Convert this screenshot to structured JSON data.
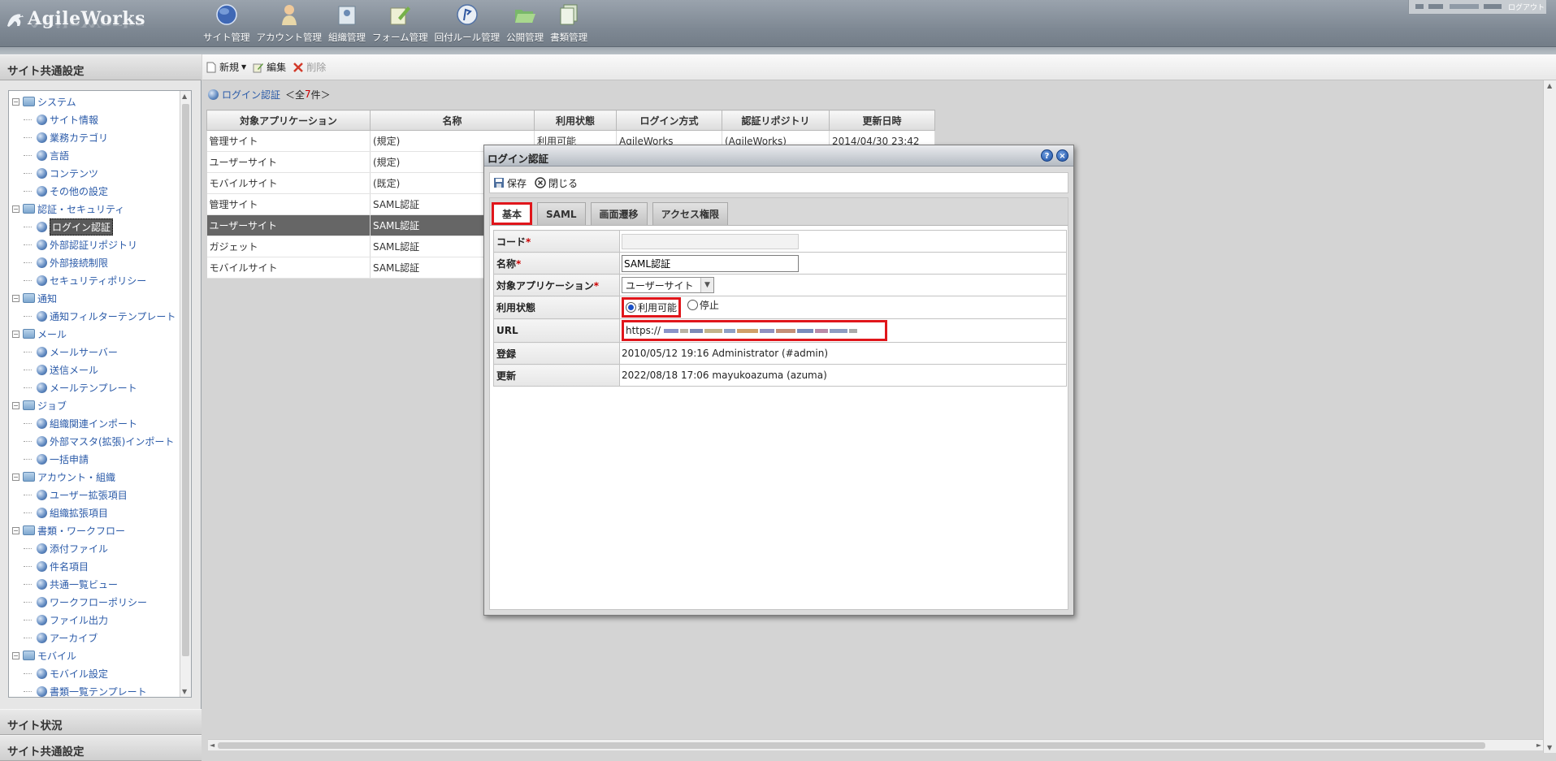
{
  "app": {
    "logo_text": "AgileWorks",
    "logout": "ログアウト"
  },
  "nav": [
    {
      "label": "サイト管理",
      "icon": "globe-icon"
    },
    {
      "label": "アカウント管理",
      "icon": "user-icon"
    },
    {
      "label": "組織管理",
      "icon": "organization-icon"
    },
    {
      "label": "フォーム管理",
      "icon": "form-edit-icon"
    },
    {
      "label": "回付ルール管理",
      "icon": "route-rule-icon"
    },
    {
      "label": "公開管理",
      "icon": "folder-open-icon"
    },
    {
      "label": "書類管理",
      "icon": "documents-icon"
    }
  ],
  "left": {
    "title": "サイト共通設定",
    "tree": [
      {
        "label": "システム",
        "type": "folder"
      },
      {
        "label": "サイト情報",
        "type": "leaf"
      },
      {
        "label": "業務カテゴリ",
        "type": "leaf"
      },
      {
        "label": "言語",
        "type": "leaf"
      },
      {
        "label": "コンテンツ",
        "type": "leaf"
      },
      {
        "label": "その他の設定",
        "type": "leaf"
      },
      {
        "label": "認証・セキュリティ",
        "type": "folder"
      },
      {
        "label": "ログイン認証",
        "type": "leaf",
        "selected": true
      },
      {
        "label": "外部認証リポジトリ",
        "type": "leaf"
      },
      {
        "label": "外部接続制限",
        "type": "leaf"
      },
      {
        "label": "セキュリティポリシー",
        "type": "leaf"
      },
      {
        "label": "通知",
        "type": "folder"
      },
      {
        "label": "通知フィルターテンプレート",
        "type": "leaf"
      },
      {
        "label": "メール",
        "type": "folder"
      },
      {
        "label": "メールサーバー",
        "type": "leaf"
      },
      {
        "label": "送信メール",
        "type": "leaf"
      },
      {
        "label": "メールテンプレート",
        "type": "leaf"
      },
      {
        "label": "ジョブ",
        "type": "folder"
      },
      {
        "label": "組織関連インポート",
        "type": "leaf"
      },
      {
        "label": "外部マスタ(拡張)インポート",
        "type": "leaf"
      },
      {
        "label": "一括申請",
        "type": "leaf"
      },
      {
        "label": "アカウント・組織",
        "type": "folder"
      },
      {
        "label": "ユーザー拡張項目",
        "type": "leaf"
      },
      {
        "label": "組織拡張項目",
        "type": "leaf"
      },
      {
        "label": "書類・ワークフロー",
        "type": "folder"
      },
      {
        "label": "添付ファイル",
        "type": "leaf"
      },
      {
        "label": "件名項目",
        "type": "leaf"
      },
      {
        "label": "共通一覧ビュー",
        "type": "leaf"
      },
      {
        "label": "ワークフローポリシー",
        "type": "leaf"
      },
      {
        "label": "ファイル出力",
        "type": "leaf"
      },
      {
        "label": "アーカイブ",
        "type": "leaf"
      },
      {
        "label": "モバイル",
        "type": "folder"
      },
      {
        "label": "モバイル設定",
        "type": "leaf"
      },
      {
        "label": "書類一覧テンプレート",
        "type": "leaf"
      }
    ],
    "bottom_titles": [
      "サイト状況",
      "サイト共通設定"
    ]
  },
  "toolbar": {
    "new_label": "新規",
    "edit_label": "編集",
    "delete_label": "削除"
  },
  "list": {
    "title": "ログイン認証",
    "count_prefix": "＜全",
    "count": "7",
    "count_suffix": "件＞",
    "columns": [
      "対象アプリケーション",
      "名称",
      "利用状態",
      "ログイン方式",
      "認証リポジトリ",
      "更新日時"
    ],
    "rows": [
      [
        "管理サイト",
        "(規定)",
        "利用可能",
        "AgileWorks",
        "(AgileWorks)",
        "2014/04/30 23:42"
      ],
      [
        "ユーザーサイト",
        "(規定)",
        "",
        "",
        "",
        ""
      ],
      [
        "モバイルサイト",
        "(既定)",
        "",
        "",
        "",
        ""
      ],
      [
        "管理サイト",
        "SAML認証",
        "",
        "",
        "",
        ""
      ],
      [
        "ユーザーサイト",
        "SAML認証",
        "",
        "",
        "",
        ""
      ],
      [
        "ガジェット",
        "SAML認証",
        "",
        "",
        "",
        ""
      ],
      [
        "モバイルサイト",
        "SAML認証",
        "",
        "",
        "",
        ""
      ]
    ],
    "selected_row": 4
  },
  "dialog": {
    "title": "ログイン認証",
    "help": "?",
    "close": "×",
    "save_label": "保存",
    "close_label": "閉じる",
    "tabs": [
      "基本",
      "SAML",
      "画面遷移",
      "アクセス権限"
    ],
    "active_tab": 0,
    "fields": {
      "code_label": "コード",
      "name_label": "名称",
      "name_value": "SAML認証",
      "app_label": "対象アプリケーション",
      "app_value": "ユーザーサイト",
      "status_label": "利用状態",
      "status_on": "利用可能",
      "status_off": "停止",
      "url_label": "URL",
      "url_value": "https://",
      "created_label": "登録",
      "created_value": "2010/05/12 19:16  Administrator (#admin)",
      "updated_label": "更新",
      "updated_value": "2022/08/18 17:06  mayukoazuma (azuma)"
    },
    "required_mark": "*"
  },
  "colors": {
    "highlight_red": "#e0161b",
    "link_blue": "#2a5aa8",
    "selected_row": "#666666"
  }
}
